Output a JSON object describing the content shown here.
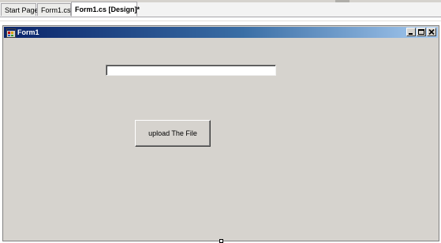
{
  "tabs": [
    {
      "label": "Start Page",
      "active": false
    },
    {
      "label": "Form1.cs*",
      "active": false
    },
    {
      "label": "Form1.cs [Design]*",
      "active": true
    }
  ],
  "form": {
    "title": "Form1",
    "title_icon": "form-app-icon",
    "caption_buttons": [
      "minimize-icon",
      "maximize-icon",
      "close-icon"
    ],
    "textbox": {
      "value": "",
      "placeholder": ""
    },
    "upload_button_label": "upload The File"
  },
  "colors": {
    "titlebar_start": "#0a246a",
    "titlebar_end": "#a6caf0",
    "form_background": "#d6d3ce"
  }
}
